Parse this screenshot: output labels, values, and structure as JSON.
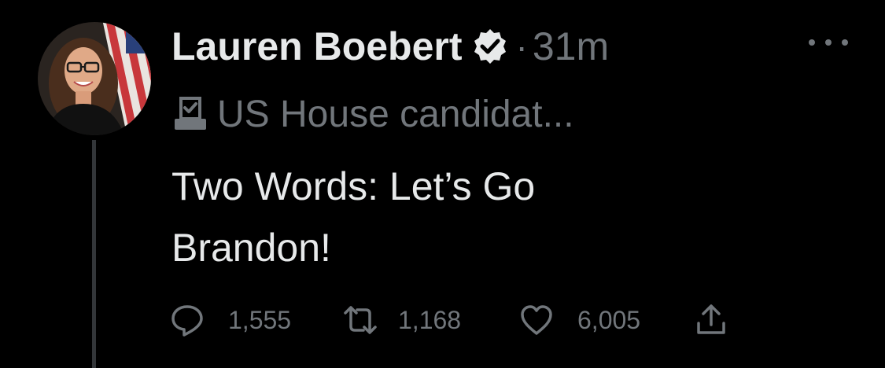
{
  "tweet": {
    "author_name": "Lauren Boebert",
    "separator": "·",
    "timestamp": "31m",
    "label": "US House candidat...",
    "text_line1": "Two Words: Let’s Go",
    "text_line2": "Brandon!"
  },
  "stats": {
    "replies": "1,555",
    "retweets": "1,168",
    "likes": "6,005"
  },
  "icons": {
    "avatar": "avatar",
    "verified": "verified-badge-icon",
    "label": "ballot-box-icon",
    "more": "more-options-icon",
    "reply": "reply-icon",
    "retweet": "retweet-icon",
    "like": "heart-icon",
    "share": "share-icon"
  },
  "colors": {
    "background": "#000000",
    "primary_text": "#e7e9ea",
    "secondary_text": "#71767b",
    "thread_line": "#333639"
  }
}
